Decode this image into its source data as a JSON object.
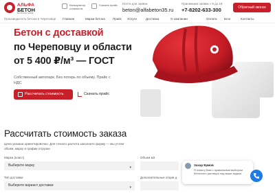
{
  "brand": {
    "name_top": "АЛЬФА",
    "name_bottom": "БЕТОН",
    "tagline": "БЕТОННЫЙ ЗАВОД"
  },
  "header": {
    "calc_tool": "Калькулятор стоимости",
    "price_tool": "Скачать прайс",
    "email_label": "Почта для заявок",
    "email": "beton@alfabeton35.ru",
    "phone_label": "Принимаем заявки с 9 до 18",
    "phone": "+7-8202-633-300",
    "callback_button": "Обратный звонок"
  },
  "nav": {
    "items": [
      "Производитель бетона в Череповце",
      "Главная",
      "Марки бетона",
      "Прайс",
      "Услуги",
      "Доставка",
      "О компании",
      "Оплата",
      "Блог",
      "Контакты"
    ]
  },
  "hero": {
    "line1": "Бетон с доставкой",
    "line2": "по Череповцу и области",
    "line3": "от 5 400 ₽/м³ — ГОСТ",
    "description": "Собственный автопарк. Без потерь по объему. Прайс с НДС",
    "calc_button": "Рассчитать стоимость",
    "price_button": "Скачать прайс"
  },
  "calculator": {
    "title": "Рассчитать стоимость заказа",
    "hint": "Цена указана ориентировочно. Для точного расчета заполните форму — мы учтем объем, марку и график отгрузки",
    "grade_label": "Марка (класс)",
    "grade_value": "Выберите марку",
    "volume_label": "Объем м3",
    "delivery_label": "Тип доставки",
    "delivery_value": "Выберите вариант доставки",
    "extra_label": "Дополнительные опции д"
  },
  "chat": {
    "name": "Захар Ермов",
    "message": "Я помогу Вам с правильным выбором бетонного раствора под ваши задачи"
  },
  "colors": {
    "accent": "#c8202b",
    "chat": "#1e7be6"
  }
}
